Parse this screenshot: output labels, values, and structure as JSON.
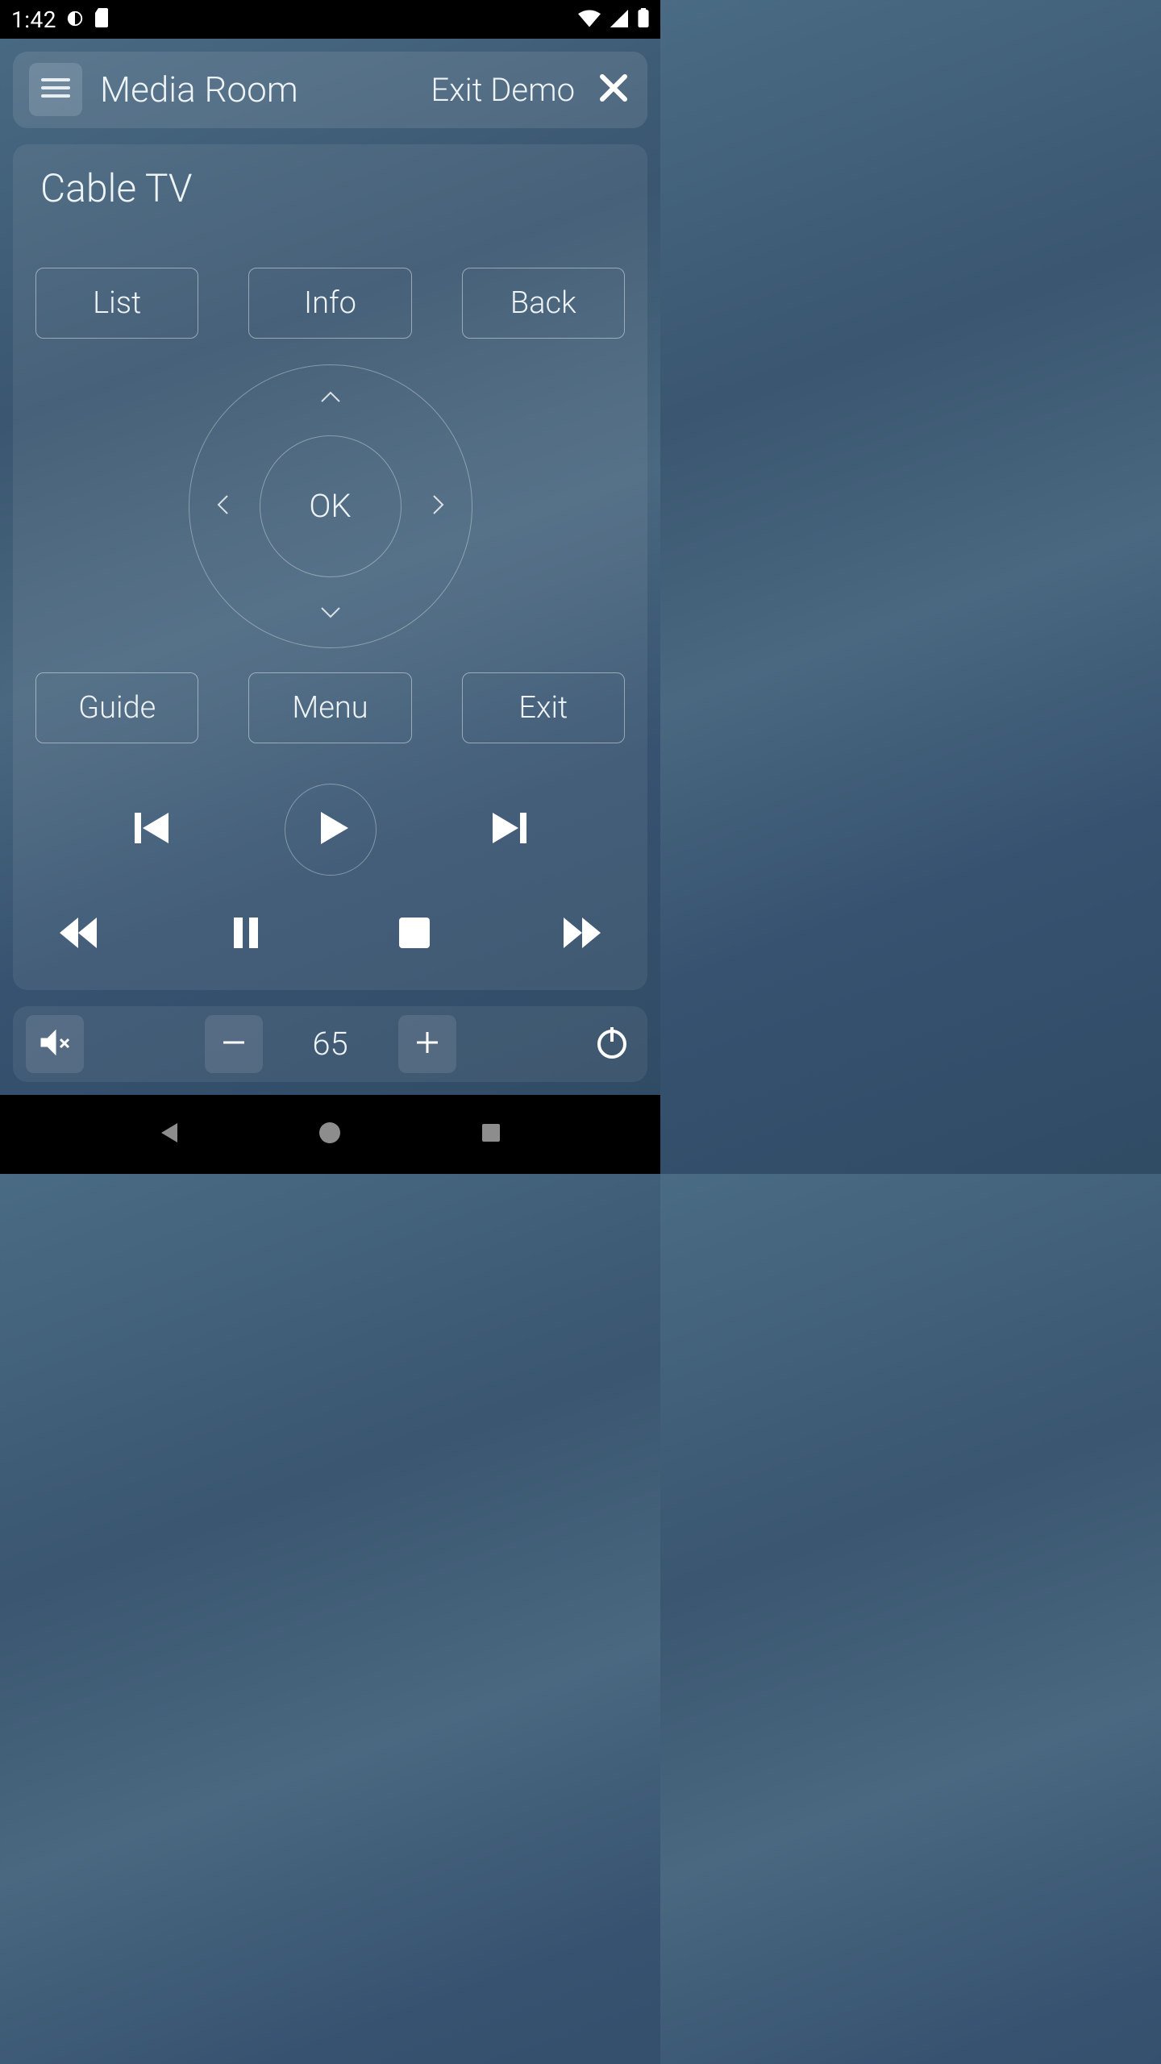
{
  "status": {
    "time": "1:42"
  },
  "header": {
    "room": "Media Room",
    "exit_demo": "Exit Demo"
  },
  "device": {
    "name": "Cable TV"
  },
  "buttons": {
    "top": {
      "list": "List",
      "info": "Info",
      "back": "Back"
    },
    "bottom": {
      "guide": "Guide",
      "menu": "Menu",
      "exit": "Exit"
    }
  },
  "dpad": {
    "ok": "OK"
  },
  "volume": {
    "level": "65"
  }
}
